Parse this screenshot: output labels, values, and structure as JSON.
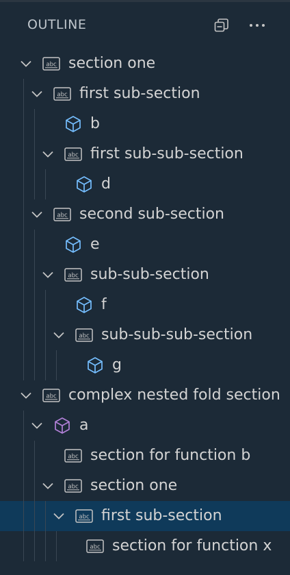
{
  "header": {
    "title": "OUTLINE"
  },
  "icons": {
    "collapse_all": "collapse-all-icon",
    "more": "more-actions-icon"
  },
  "colors": {
    "string": "#c5c5c5",
    "variable": "#75beff",
    "function": "#b180d7",
    "selection": "#0f3a5a"
  },
  "tree": [
    {
      "label": "section one",
      "depth": 0,
      "kind": "string",
      "expanded": true
    },
    {
      "label": "first sub-section",
      "depth": 1,
      "kind": "string",
      "expanded": true
    },
    {
      "label": "b",
      "depth": 2,
      "kind": "variable"
    },
    {
      "label": "first sub-sub-section",
      "depth": 2,
      "kind": "string",
      "expanded": true
    },
    {
      "label": "d",
      "depth": 3,
      "kind": "variable"
    },
    {
      "label": "second sub-section",
      "depth": 1,
      "kind": "string",
      "expanded": true
    },
    {
      "label": "e",
      "depth": 2,
      "kind": "variable"
    },
    {
      "label": "sub-sub-section",
      "depth": 2,
      "kind": "string",
      "expanded": true
    },
    {
      "label": "f",
      "depth": 3,
      "kind": "variable"
    },
    {
      "label": "sub-sub-sub-section",
      "depth": 3,
      "kind": "string",
      "expanded": true
    },
    {
      "label": "g",
      "depth": 4,
      "kind": "variable"
    },
    {
      "label": "complex nested fold section",
      "depth": 0,
      "kind": "string",
      "expanded": true
    },
    {
      "label": "a",
      "depth": 1,
      "kind": "function",
      "expanded": true
    },
    {
      "label": "section for function b",
      "depth": 2,
      "kind": "string"
    },
    {
      "label": "section one",
      "depth": 2,
      "kind": "string",
      "expanded": true
    },
    {
      "label": "first sub-section",
      "depth": 3,
      "kind": "string",
      "expanded": true,
      "selected": true
    },
    {
      "label": "section for function x",
      "depth": 4,
      "kind": "string"
    }
  ]
}
